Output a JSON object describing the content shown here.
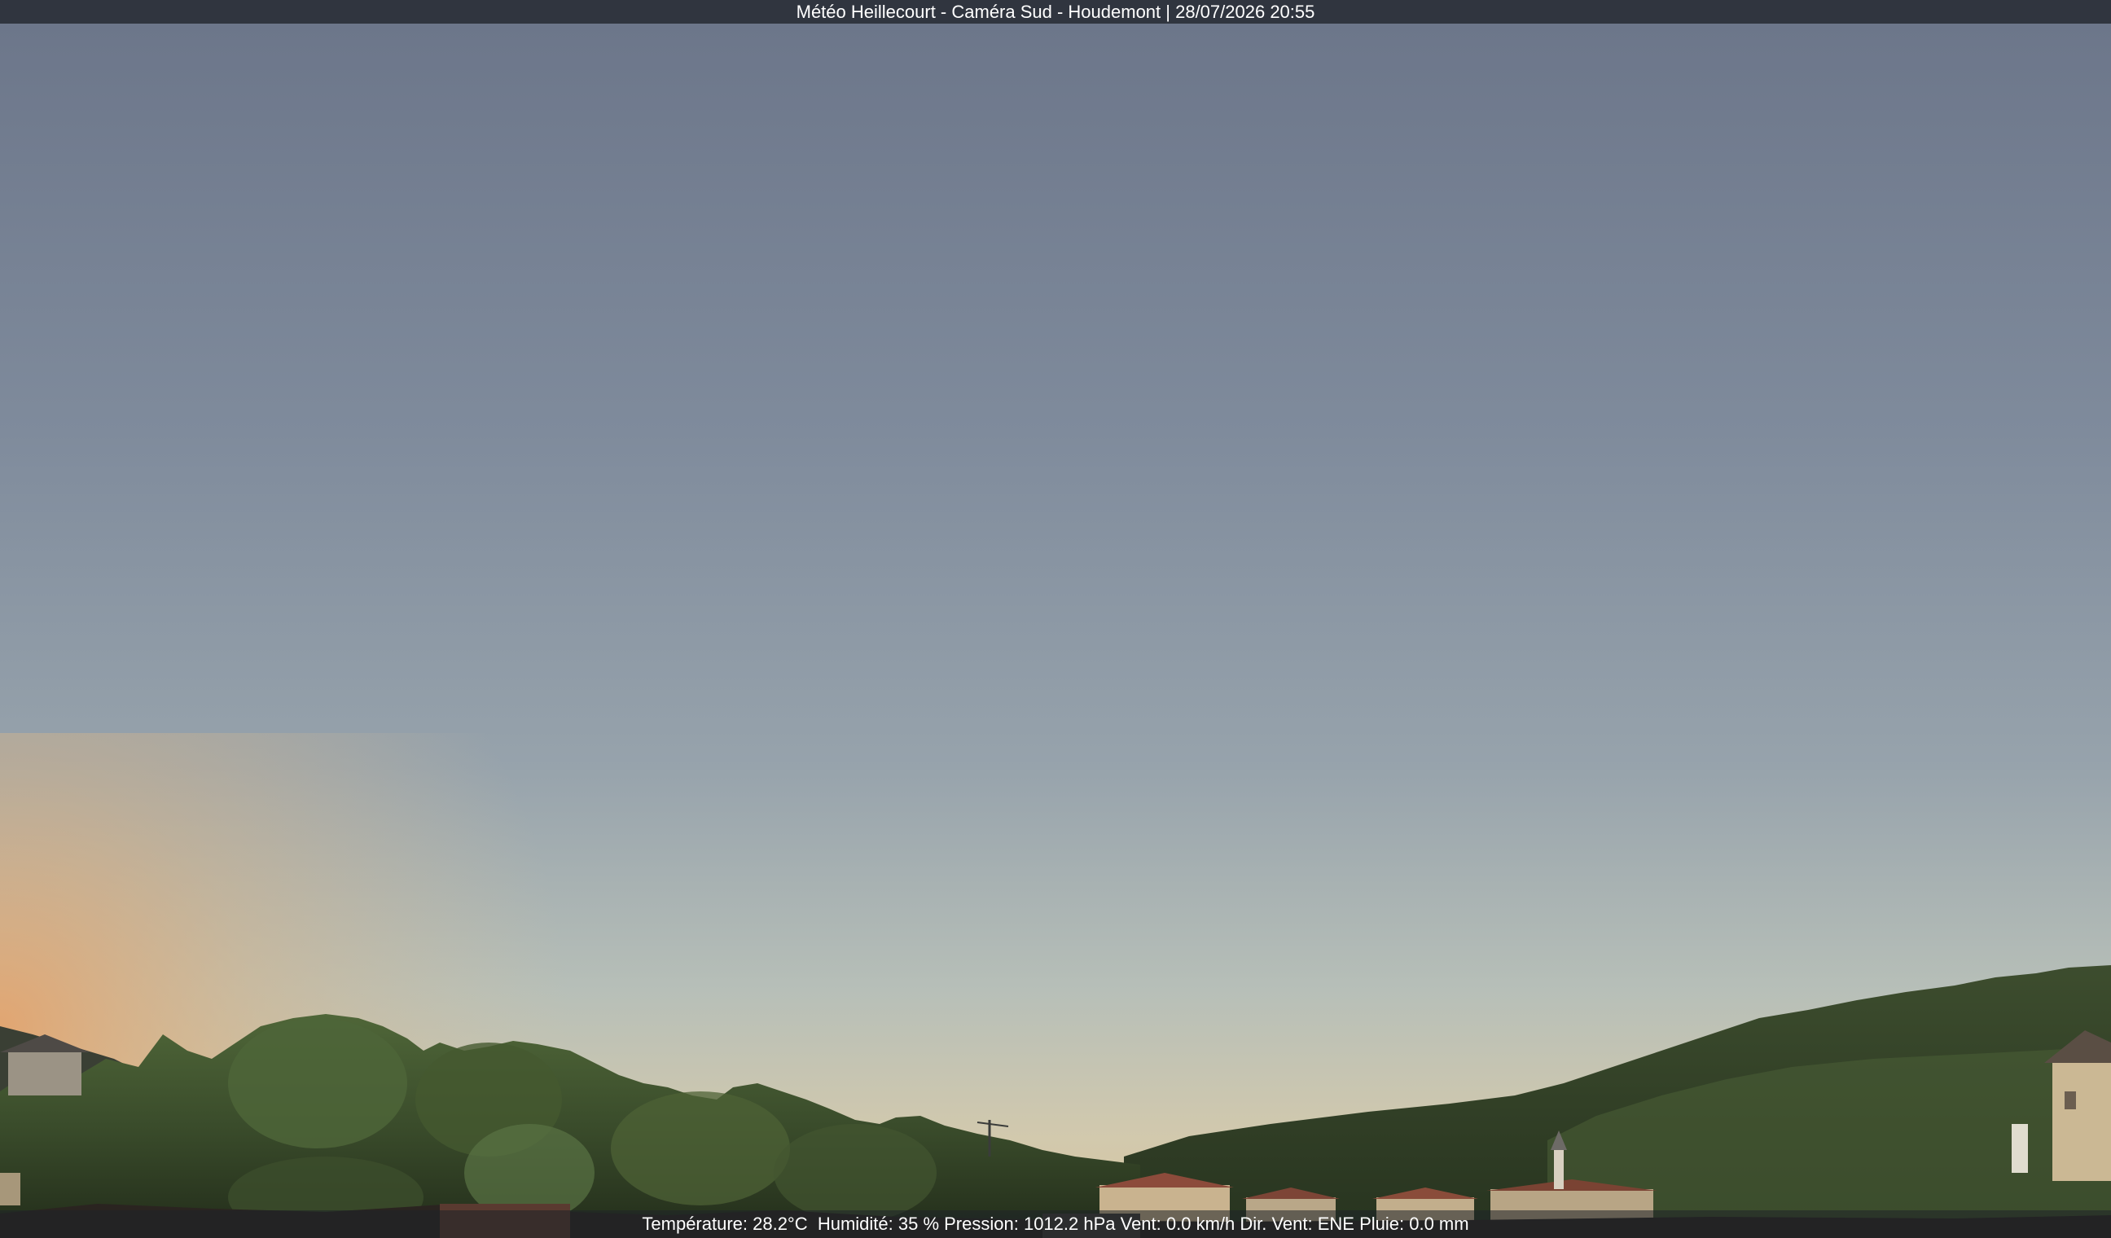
{
  "overlay": {
    "title": "Météo Heillecourt - Caméra Sud - Houdemont | 28/07/2026 20:55",
    "info": "Température: 28.2°C  Humidité: 35 % Pression: 1012.2 hPa Vent: 0.0 km/h Dir. Vent: ENE Pluie: 0.0 mm"
  },
  "colors": {
    "sky_top": "#6b7589",
    "sky_mid": "#8794a3",
    "sky_low": "#a4b0b4",
    "horizon_glow": "#d6c6a4",
    "horizon_warm": "#e0a774",
    "trees_dark": "#1f2a1c",
    "trees_mid": "#36472c",
    "trees_light": "#58703f",
    "roofs": "#8a4a3a",
    "walls": "#c8b99a"
  }
}
